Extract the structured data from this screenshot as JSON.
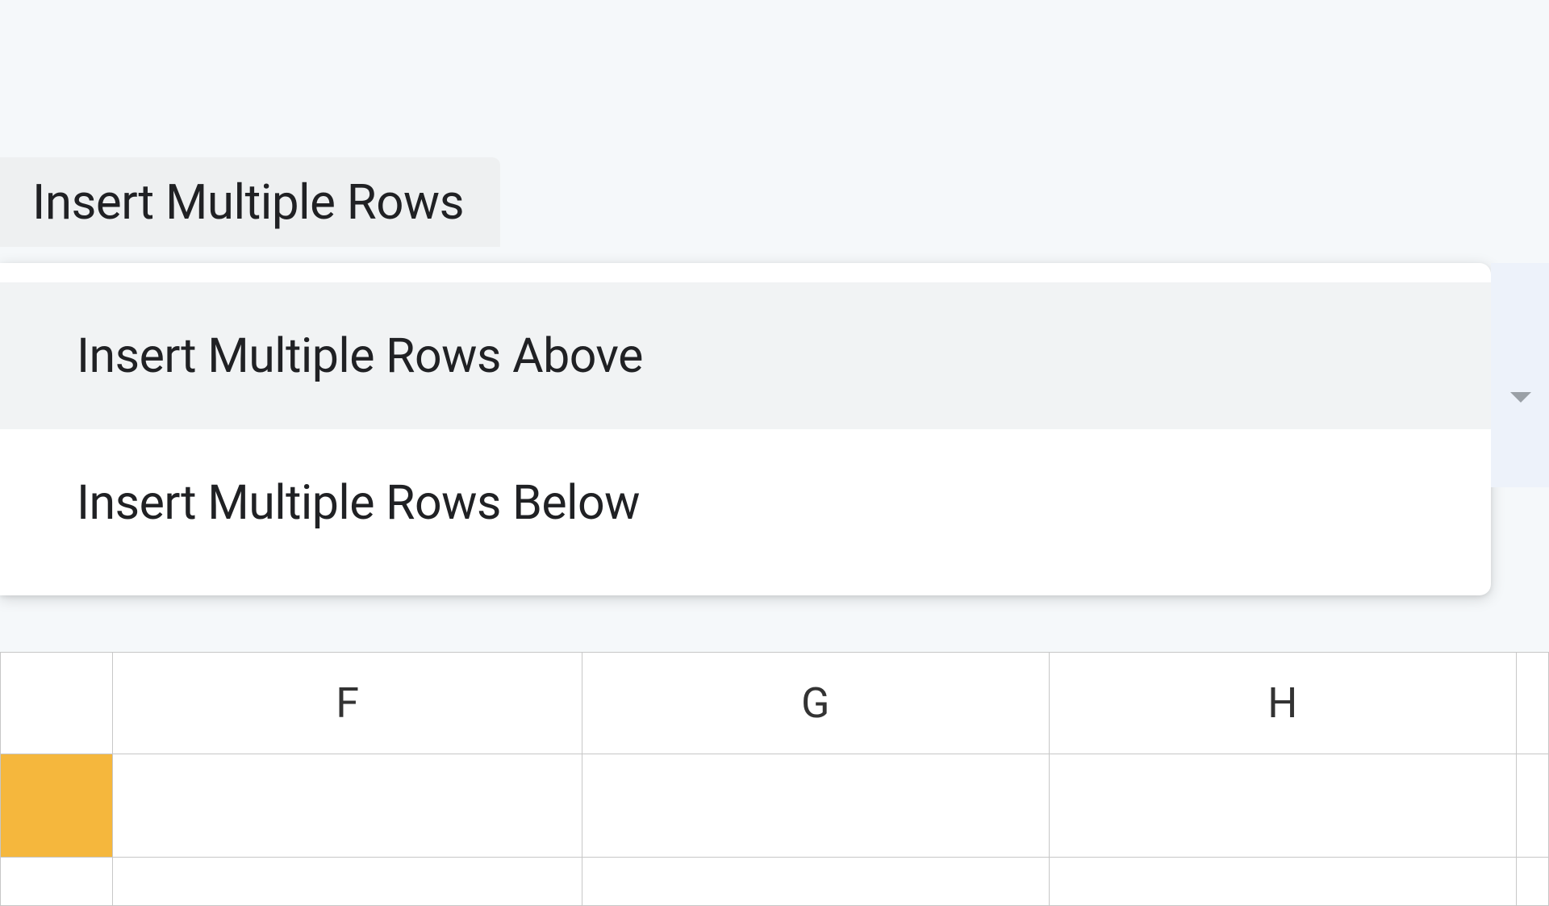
{
  "menu": {
    "tab_label": "Insert Multiple Rows",
    "items": [
      {
        "label": "Insert Multiple Rows Above",
        "highlighted": true
      },
      {
        "label": "Insert Multiple Rows Below",
        "highlighted": false
      }
    ]
  },
  "spreadsheet": {
    "visible_columns": [
      "F",
      "G",
      "H"
    ]
  }
}
